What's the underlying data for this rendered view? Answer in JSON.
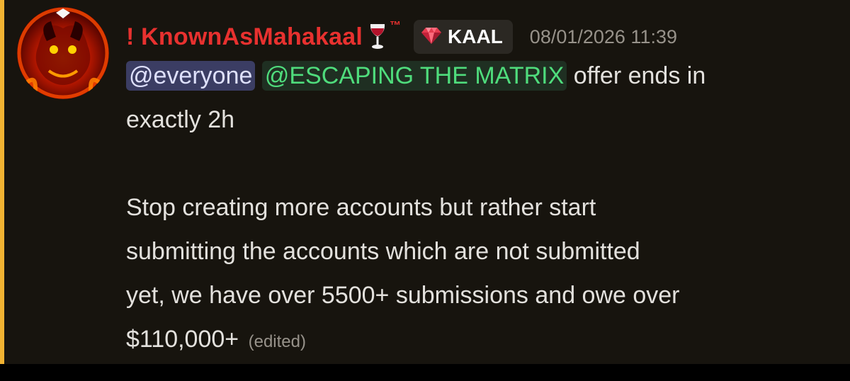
{
  "message": {
    "author": {
      "name": "! KnownAsMahakaal",
      "name_color": "#e8312f",
      "badge_icon": "wine-glass-icon",
      "trademark": "™"
    },
    "tag": {
      "icon": "gem-icon",
      "label": "KAAL"
    },
    "timestamp": "08/01/2026 11:39",
    "mentions": {
      "everyone": "@everyone",
      "role": "@ESCAPING THE MATRIX"
    },
    "text": {
      "line1_rest": " offer ends in",
      "line2": "exactly 2h",
      "line4": "Stop creating more accounts but rather start",
      "line5": "submitting the accounts which are not submitted",
      "line6": "yet, we have over 5500+ submissions and owe over",
      "line7": "$110,000+"
    },
    "edited_label": "(edited)"
  },
  "colors": {
    "accent_bar": "#f0b232",
    "background": "#17140e",
    "text": "#e3e1dd",
    "timestamp": "#97928a",
    "mention_everyone_bg": "#3b3d63",
    "mention_role_text": "#4fdc7c"
  }
}
